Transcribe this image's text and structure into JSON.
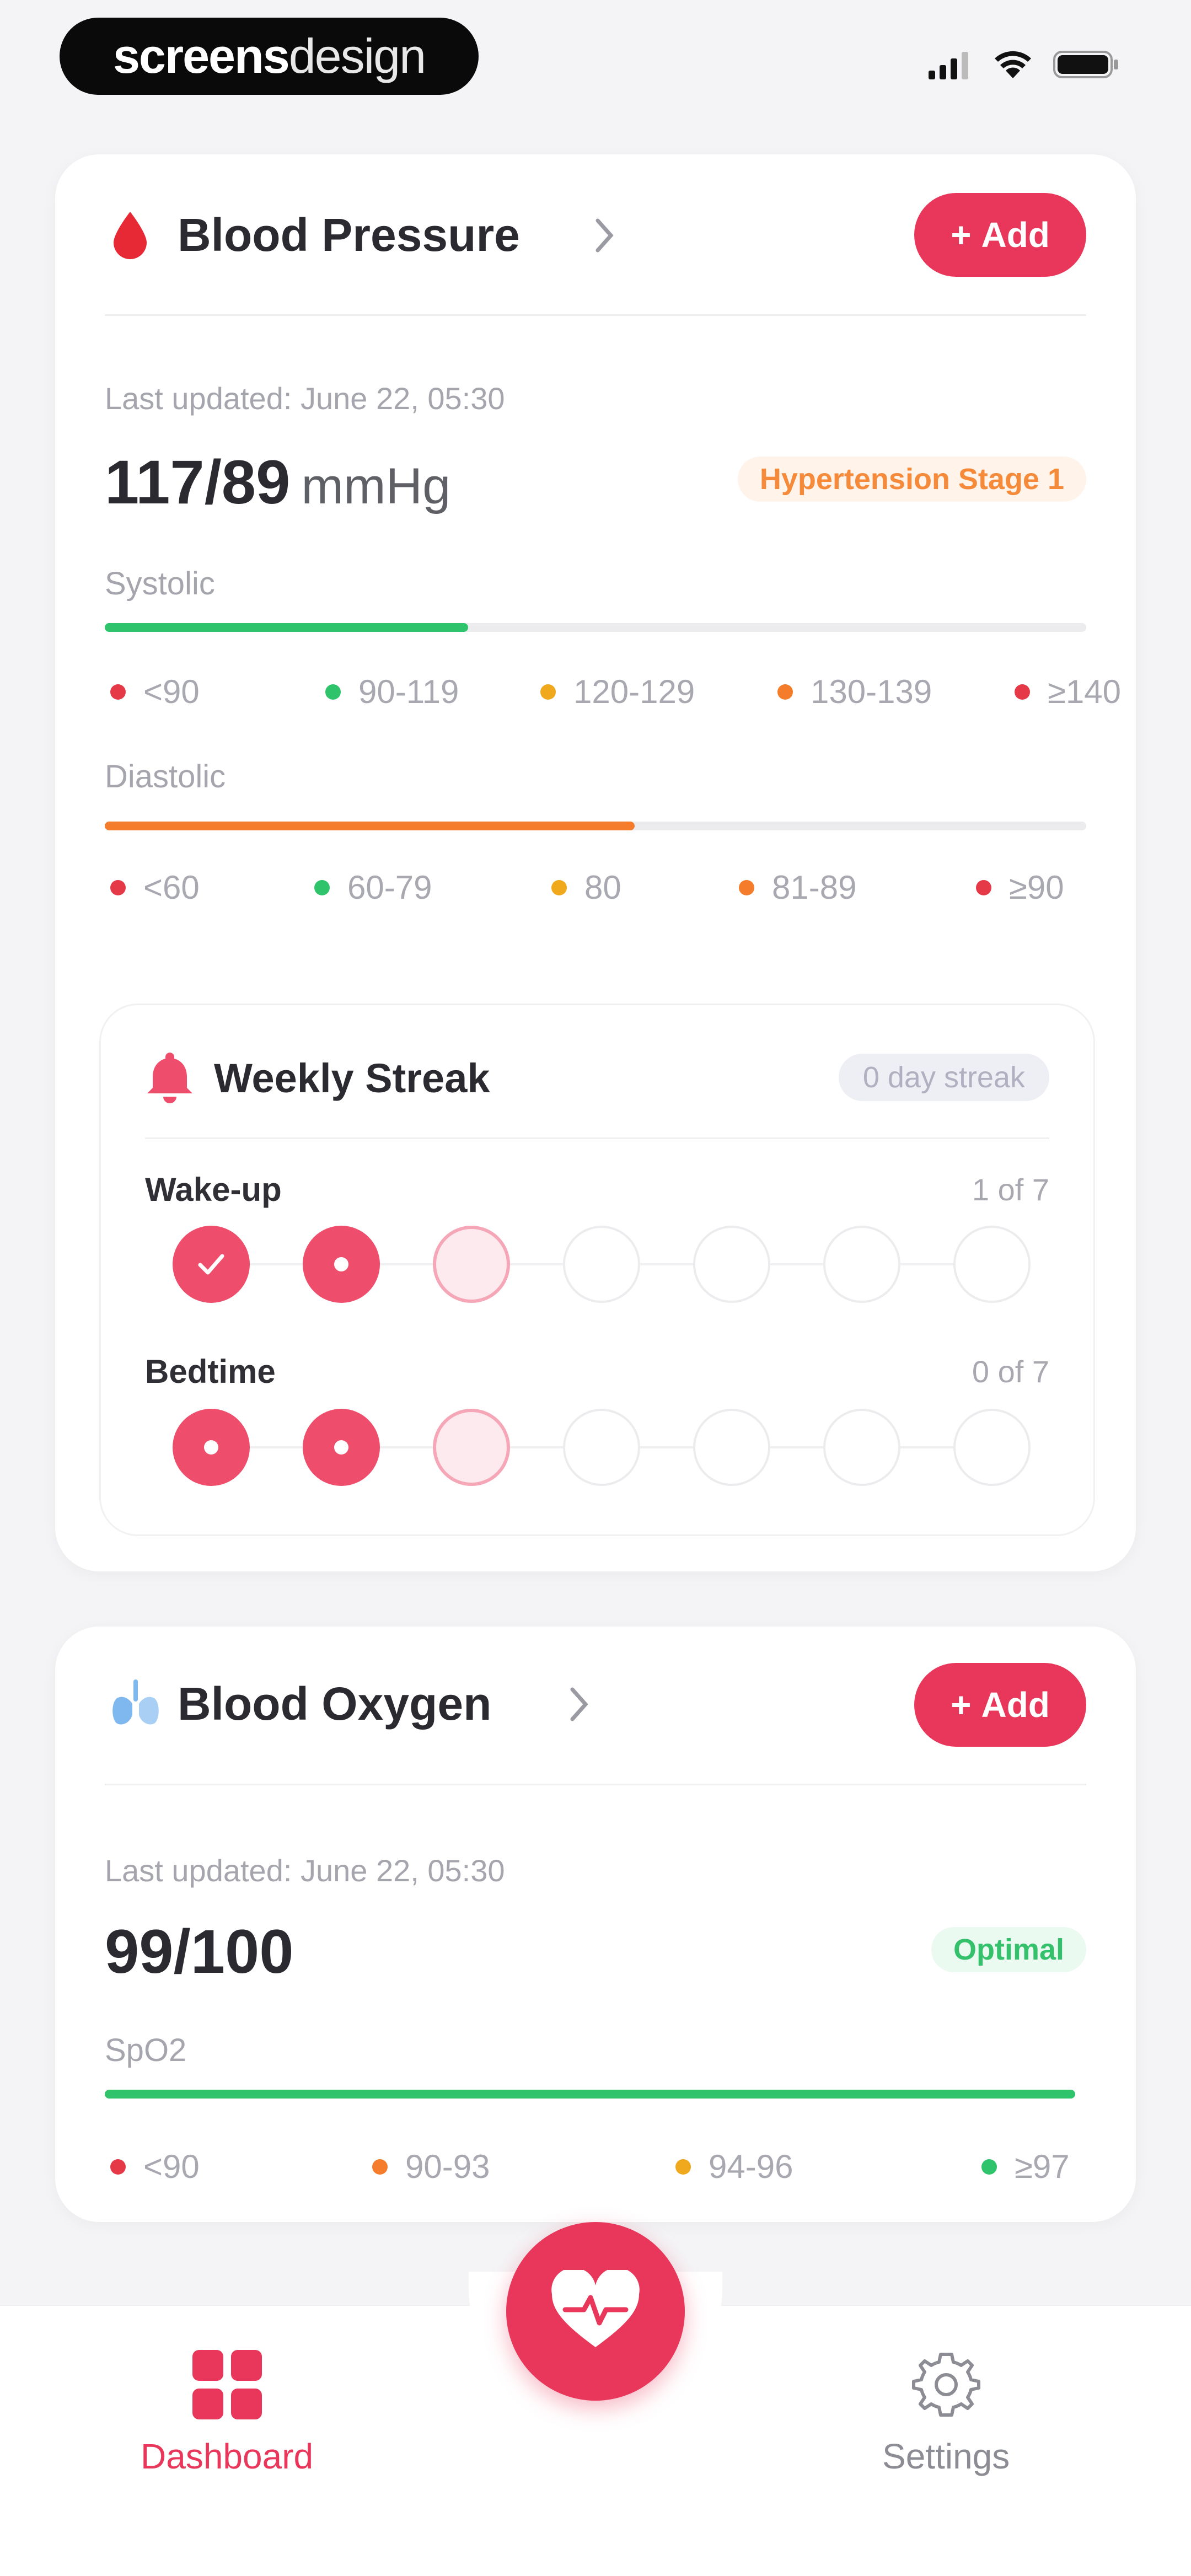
{
  "brand": {
    "logo_bold": "screens",
    "logo_light": "design"
  },
  "colors": {
    "accent": "#e8375a",
    "green": "#2fc46b",
    "orange": "#f57c2a",
    "amber": "#f0a81c",
    "red": "#e53948"
  },
  "blood_pressure": {
    "title": "Blood Pressure",
    "add_label": "Add",
    "last_updated": "Last updated: June 22, 05:30",
    "value": "117/89",
    "unit": "mmHg",
    "status": "Hypertension Stage 1",
    "systolic": {
      "label": "Systolic",
      "fill_fraction": 0.37,
      "ranges": [
        "<90",
        "90-119",
        "120-129",
        "130-139",
        "≥140"
      ]
    },
    "diastolic": {
      "label": "Diastolic",
      "fill_fraction": 0.54,
      "ranges": [
        "<60",
        "60-79",
        "80",
        "81-89",
        "≥90"
      ]
    }
  },
  "streak": {
    "title": "Weekly Streak",
    "badge": "0 day streak",
    "wakeup": {
      "label": "Wake-up",
      "count": "1 of 7",
      "states": [
        "check",
        "dot",
        "today",
        "future",
        "future",
        "future",
        "future"
      ]
    },
    "bedtime": {
      "label": "Bedtime",
      "count": "0 of 7",
      "states": [
        "dot",
        "dot",
        "today",
        "future",
        "future",
        "future",
        "future"
      ]
    }
  },
  "blood_oxygen": {
    "title": "Blood Oxygen",
    "add_label": "Add",
    "last_updated": "Last updated: June 22, 05:30",
    "value": "99/100",
    "status": "Optimal",
    "spo2": {
      "label": "SpO2",
      "fill_fraction": 1.0,
      "ranges": [
        "<90",
        "90-93",
        "94-96",
        "≥97"
      ]
    }
  },
  "nav": {
    "dashboard": "Dashboard",
    "settings": "Settings"
  }
}
